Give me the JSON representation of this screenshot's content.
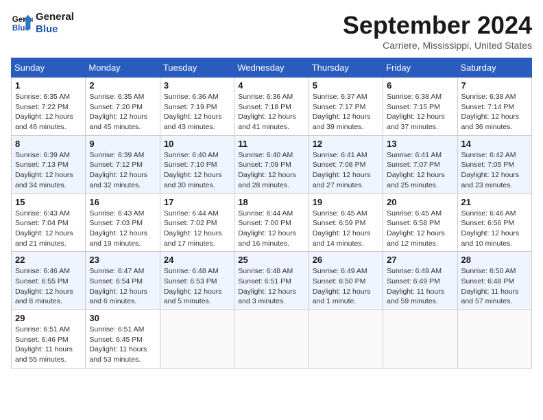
{
  "header": {
    "logo_line1": "General",
    "logo_line2": "Blue",
    "month_title": "September 2024",
    "location": "Carriere, Mississippi, United States"
  },
  "weekdays": [
    "Sunday",
    "Monday",
    "Tuesday",
    "Wednesday",
    "Thursday",
    "Friday",
    "Saturday"
  ],
  "weeks": [
    [
      {
        "day": "1",
        "info": "Sunrise: 6:35 AM\nSunset: 7:22 PM\nDaylight: 12 hours\nand 46 minutes."
      },
      {
        "day": "2",
        "info": "Sunrise: 6:35 AM\nSunset: 7:20 PM\nDaylight: 12 hours\nand 45 minutes."
      },
      {
        "day": "3",
        "info": "Sunrise: 6:36 AM\nSunset: 7:19 PM\nDaylight: 12 hours\nand 43 minutes."
      },
      {
        "day": "4",
        "info": "Sunrise: 6:36 AM\nSunset: 7:18 PM\nDaylight: 12 hours\nand 41 minutes."
      },
      {
        "day": "5",
        "info": "Sunrise: 6:37 AM\nSunset: 7:17 PM\nDaylight: 12 hours\nand 39 minutes."
      },
      {
        "day": "6",
        "info": "Sunrise: 6:38 AM\nSunset: 7:15 PM\nDaylight: 12 hours\nand 37 minutes."
      },
      {
        "day": "7",
        "info": "Sunrise: 6:38 AM\nSunset: 7:14 PM\nDaylight: 12 hours\nand 36 minutes."
      }
    ],
    [
      {
        "day": "8",
        "info": "Sunrise: 6:39 AM\nSunset: 7:13 PM\nDaylight: 12 hours\nand 34 minutes."
      },
      {
        "day": "9",
        "info": "Sunrise: 6:39 AM\nSunset: 7:12 PM\nDaylight: 12 hours\nand 32 minutes."
      },
      {
        "day": "10",
        "info": "Sunrise: 6:40 AM\nSunset: 7:10 PM\nDaylight: 12 hours\nand 30 minutes."
      },
      {
        "day": "11",
        "info": "Sunrise: 6:40 AM\nSunset: 7:09 PM\nDaylight: 12 hours\nand 28 minutes."
      },
      {
        "day": "12",
        "info": "Sunrise: 6:41 AM\nSunset: 7:08 PM\nDaylight: 12 hours\nand 27 minutes."
      },
      {
        "day": "13",
        "info": "Sunrise: 6:41 AM\nSunset: 7:07 PM\nDaylight: 12 hours\nand 25 minutes."
      },
      {
        "day": "14",
        "info": "Sunrise: 6:42 AM\nSunset: 7:05 PM\nDaylight: 12 hours\nand 23 minutes."
      }
    ],
    [
      {
        "day": "15",
        "info": "Sunrise: 6:43 AM\nSunset: 7:04 PM\nDaylight: 12 hours\nand 21 minutes."
      },
      {
        "day": "16",
        "info": "Sunrise: 6:43 AM\nSunset: 7:03 PM\nDaylight: 12 hours\nand 19 minutes."
      },
      {
        "day": "17",
        "info": "Sunrise: 6:44 AM\nSunset: 7:02 PM\nDaylight: 12 hours\nand 17 minutes."
      },
      {
        "day": "18",
        "info": "Sunrise: 6:44 AM\nSunset: 7:00 PM\nDaylight: 12 hours\nand 16 minutes."
      },
      {
        "day": "19",
        "info": "Sunrise: 6:45 AM\nSunset: 6:59 PM\nDaylight: 12 hours\nand 14 minutes."
      },
      {
        "day": "20",
        "info": "Sunrise: 6:45 AM\nSunset: 6:58 PM\nDaylight: 12 hours\nand 12 minutes."
      },
      {
        "day": "21",
        "info": "Sunrise: 6:46 AM\nSunset: 6:56 PM\nDaylight: 12 hours\nand 10 minutes."
      }
    ],
    [
      {
        "day": "22",
        "info": "Sunrise: 6:46 AM\nSunset: 6:55 PM\nDaylight: 12 hours\nand 8 minutes."
      },
      {
        "day": "23",
        "info": "Sunrise: 6:47 AM\nSunset: 6:54 PM\nDaylight: 12 hours\nand 6 minutes."
      },
      {
        "day": "24",
        "info": "Sunrise: 6:48 AM\nSunset: 6:53 PM\nDaylight: 12 hours\nand 5 minutes."
      },
      {
        "day": "25",
        "info": "Sunrise: 6:48 AM\nSunset: 6:51 PM\nDaylight: 12 hours\nand 3 minutes."
      },
      {
        "day": "26",
        "info": "Sunrise: 6:49 AM\nSunset: 6:50 PM\nDaylight: 12 hours\nand 1 minute."
      },
      {
        "day": "27",
        "info": "Sunrise: 6:49 AM\nSunset: 6:49 PM\nDaylight: 11 hours\nand 59 minutes."
      },
      {
        "day": "28",
        "info": "Sunrise: 6:50 AM\nSunset: 6:48 PM\nDaylight: 11 hours\nand 57 minutes."
      }
    ],
    [
      {
        "day": "29",
        "info": "Sunrise: 6:51 AM\nSunset: 6:46 PM\nDaylight: 11 hours\nand 55 minutes."
      },
      {
        "day": "30",
        "info": "Sunrise: 6:51 AM\nSunset: 6:45 PM\nDaylight: 11 hours\nand 53 minutes."
      },
      {
        "day": "",
        "info": ""
      },
      {
        "day": "",
        "info": ""
      },
      {
        "day": "",
        "info": ""
      },
      {
        "day": "",
        "info": ""
      },
      {
        "day": "",
        "info": ""
      }
    ]
  ]
}
